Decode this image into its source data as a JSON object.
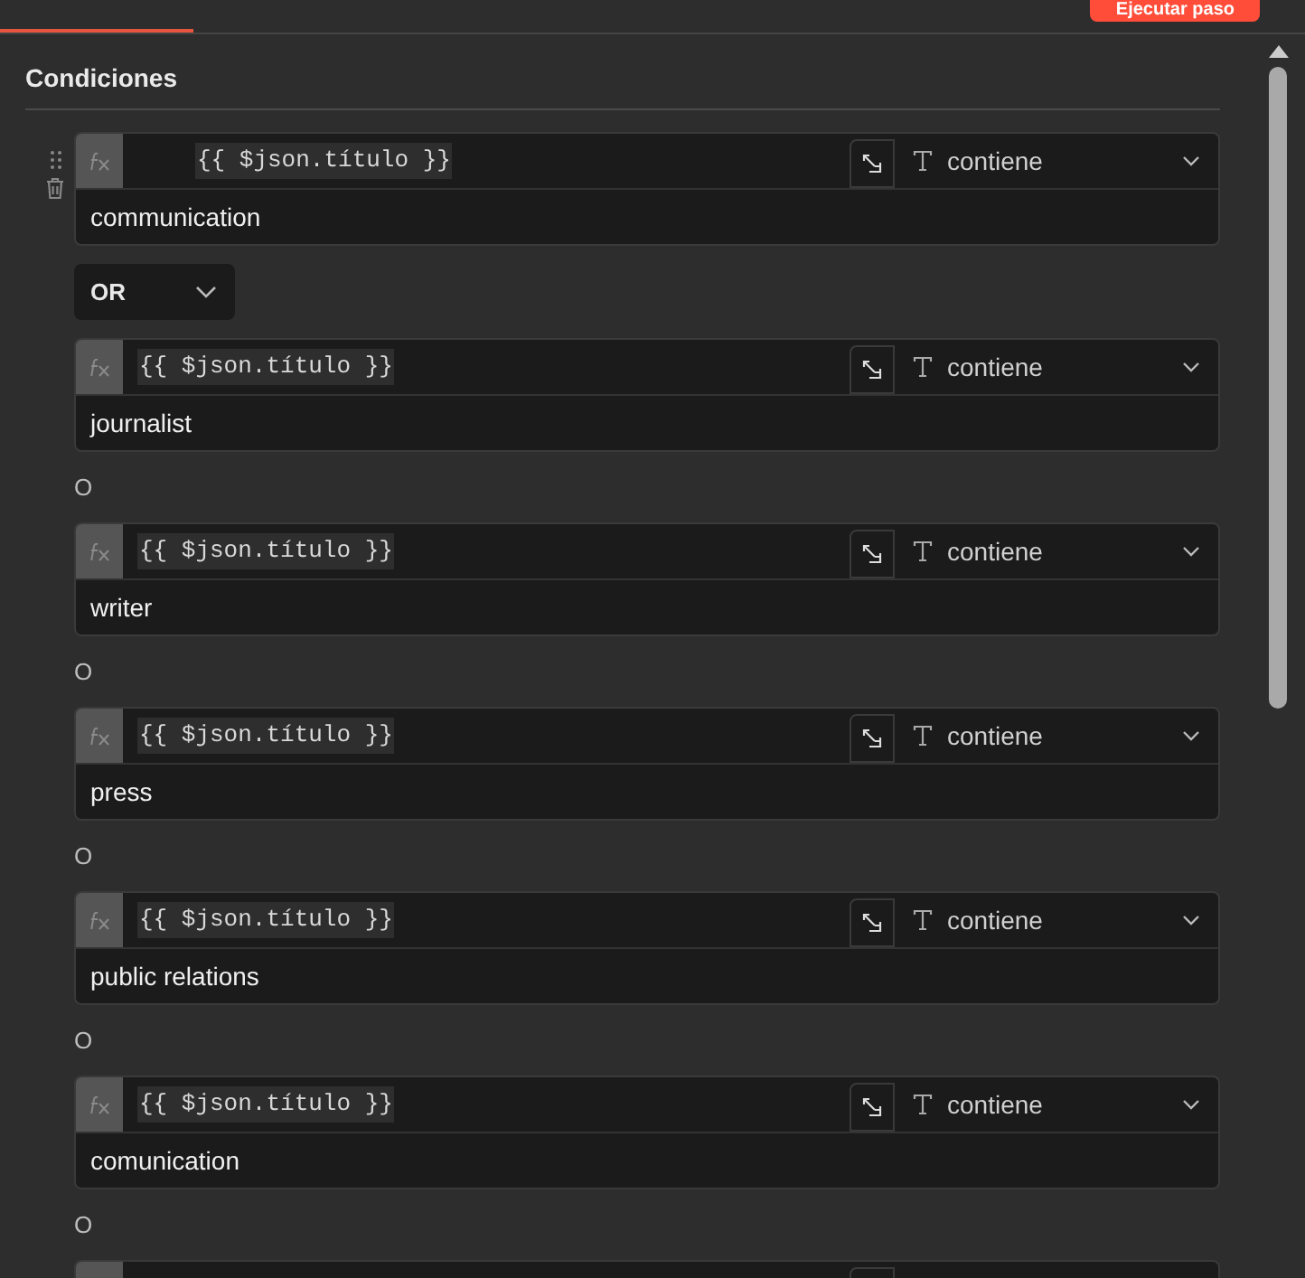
{
  "header": {
    "run_button": "Ejecutar paso"
  },
  "section": {
    "title": "Condiciones"
  },
  "conditions": [
    {
      "left": "{{ $json.título }}",
      "operator": "contiene",
      "value": "communication",
      "hovered": true
    },
    {
      "combinator": "OR",
      "kind": "dropdown",
      "left": "{{ $json.título }}",
      "operator": "contiene",
      "value": "journalist",
      "hovered": false
    },
    {
      "combinator": "O",
      "kind": "text",
      "left": "{{ $json.título }}",
      "operator": "contiene",
      "value": "writer",
      "hovered": false
    },
    {
      "combinator": "O",
      "kind": "text",
      "left": "{{ $json.título }}",
      "operator": "contiene",
      "value": "press",
      "hovered": false
    },
    {
      "combinator": "O",
      "kind": "text",
      "left": "{{ $json.título }}",
      "operator": "contiene",
      "value": "public relations",
      "hovered": false
    },
    {
      "combinator": "O",
      "kind": "text",
      "left": "{{ $json.título }}",
      "operator": "contiene",
      "value": "comunication",
      "hovered": false
    },
    {
      "combinator": "O",
      "kind": "text"
    }
  ]
}
